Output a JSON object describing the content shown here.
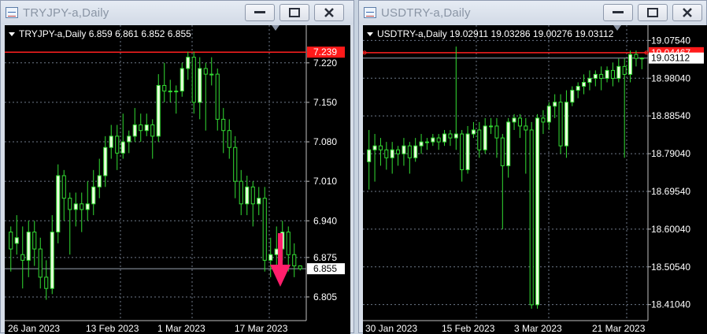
{
  "windows": [
    {
      "id": "tryjpy",
      "title": "TRYJPY-a,Daily",
      "info_label": "TRYJPY-a,Daily  6.859 6.861 6.852 6.855",
      "price_labels": [
        "7.220",
        "7.150",
        "7.080",
        "7.010",
        "6.940",
        "6.875",
        "6.805"
      ],
      "date_labels": [
        "26 Jan 2023",
        "13 Feb 2023",
        "1 Mar 2023",
        "17 Mar 2023"
      ],
      "red_line_label": "7.239",
      "current_price_label": "6.855",
      "chart_data": {
        "type": "candlestick",
        "symbol": "TRYJPY-a",
        "timeframe": "Daily",
        "ohlc_header": {
          "open": 6.859,
          "high": 6.861,
          "low": 6.852,
          "close": 6.855
        },
        "ylim": [
          6.77,
          7.27
        ],
        "y_ticks": [
          7.22,
          7.15,
          7.08,
          7.01,
          6.94,
          6.875,
          6.805
        ],
        "x_ticks": [
          "26 Jan 2023",
          "13 Feb 2023",
          "1 Mar 2023",
          "17 Mar 2023"
        ],
        "horizontal_line": 7.239,
        "current_price": 6.855,
        "candles": [
          [
            6.92,
            6.89,
            6.93,
            6.85
          ],
          [
            6.9,
            6.91,
            6.95,
            6.88
          ],
          [
            6.88,
            6.87,
            6.93,
            6.82
          ],
          [
            6.87,
            6.92,
            6.94,
            6.84
          ],
          [
            6.92,
            6.89,
            6.94,
            6.86
          ],
          [
            6.89,
            6.84,
            6.91,
            6.82
          ],
          [
            6.84,
            6.82,
            6.87,
            6.8
          ],
          [
            6.82,
            6.92,
            6.95,
            6.81
          ],
          [
            6.92,
            7.02,
            7.04,
            6.9
          ],
          [
            7.02,
            6.98,
            7.03,
            6.94
          ],
          [
            6.98,
            6.96,
            6.99,
            6.88
          ],
          [
            6.96,
            6.97,
            6.99,
            6.93
          ],
          [
            6.97,
            6.96,
            6.99,
            6.92
          ],
          [
            6.96,
            6.97,
            7.01,
            6.94
          ],
          [
            6.97,
            7.0,
            7.03,
            6.95
          ],
          [
            7.0,
            7.02,
            7.05,
            6.98
          ],
          [
            7.02,
            7.07,
            7.09,
            7.0
          ],
          [
            7.07,
            7.09,
            7.11,
            7.05
          ],
          [
            7.09,
            7.06,
            7.11,
            7.03
          ],
          [
            7.06,
            7.08,
            7.13,
            7.05
          ],
          [
            7.08,
            7.09,
            7.1,
            7.06
          ],
          [
            7.09,
            7.11,
            7.14,
            7.08
          ],
          [
            7.11,
            7.1,
            7.13,
            7.08
          ],
          [
            7.1,
            7.11,
            7.13,
            7.09
          ],
          [
            7.11,
            7.09,
            7.12,
            7.05
          ],
          [
            7.09,
            7.18,
            7.2,
            7.08
          ],
          [
            7.18,
            7.17,
            7.22,
            7.15
          ],
          [
            7.17,
            7.17,
            7.19,
            7.15
          ],
          [
            7.17,
            7.17,
            7.18,
            7.13
          ],
          [
            7.17,
            7.21,
            7.22,
            7.16
          ],
          [
            7.21,
            7.23,
            7.24,
            7.19
          ],
          [
            7.23,
            7.15,
            7.24,
            7.13
          ],
          [
            7.15,
            7.21,
            7.23,
            7.12
          ],
          [
            7.21,
            7.2,
            7.22,
            7.1
          ],
          [
            7.2,
            7.2,
            7.23,
            7.18
          ],
          [
            7.2,
            7.12,
            7.21,
            7.1
          ],
          [
            7.12,
            7.1,
            7.14,
            7.06
          ],
          [
            7.1,
            7.07,
            7.12,
            7.05
          ],
          [
            7.07,
            7.01,
            7.09,
            6.98
          ],
          [
            7.01,
            6.97,
            7.03,
            6.95
          ],
          [
            6.97,
            7.0,
            7.02,
            6.95
          ],
          [
            7.0,
            6.97,
            7.01,
            6.93
          ],
          [
            6.97,
            6.98,
            7.0,
            6.95
          ],
          [
            6.98,
            6.87,
            7.0,
            6.85
          ],
          [
            6.87,
            6.88,
            6.91,
            6.84
          ],
          [
            6.88,
            6.89,
            6.93,
            6.86
          ],
          [
            6.89,
            6.92,
            6.94,
            6.87
          ],
          [
            6.92,
            6.88,
            6.93,
            6.85
          ],
          [
            6.88,
            6.86,
            6.9,
            6.84
          ],
          [
            6.86,
            6.855,
            6.861,
            6.852
          ]
        ]
      }
    },
    {
      "id": "usdtry",
      "title": "USDTRY-a,Daily",
      "info_label": "USDTRY-a,Daily  19.02911 19.03286 19.00276 19.03112",
      "price_labels": [
        "19.07540",
        "18.98040",
        "18.88540",
        "18.79040",
        "18.69540",
        "18.60040",
        "18.50540",
        "18.41040"
      ],
      "date_labels": [
        "30 Jan 2023",
        "15 Feb 2023",
        "3 Mar 2023",
        "21 Mar 2023"
      ],
      "red_line_label": "19.04467",
      "current_price_label": "19.03112",
      "chart_data": {
        "type": "candlestick",
        "symbol": "USDTRY-a",
        "timeframe": "Daily",
        "ohlc_header": {
          "open": 19.02911,
          "high": 19.03286,
          "low": 19.00276,
          "close": 19.03112
        },
        "ylim": [
          18.38,
          19.09
        ],
        "y_ticks": [
          19.0754,
          18.9804,
          18.8854,
          18.7904,
          18.6954,
          18.6004,
          18.5054,
          18.4104
        ],
        "x_ticks": [
          "30 Jan 2023",
          "15 Feb 2023",
          "3 Mar 2023",
          "21 Mar 2023"
        ],
        "horizontal_line": 19.04467,
        "current_price": 19.03112,
        "candles": [
          [
            18.77,
            18.8,
            18.85,
            18.7
          ],
          [
            18.8,
            18.81,
            18.84,
            18.72
          ],
          [
            18.81,
            18.8,
            18.83,
            18.76
          ],
          [
            18.8,
            18.78,
            18.82,
            18.75
          ],
          [
            18.78,
            18.8,
            18.82,
            18.74
          ],
          [
            18.8,
            18.79,
            18.81,
            18.76
          ],
          [
            18.79,
            18.81,
            18.83,
            18.76
          ],
          [
            18.81,
            18.78,
            18.82,
            18.74
          ],
          [
            18.78,
            18.81,
            18.83,
            18.77
          ],
          [
            18.81,
            18.82,
            18.84,
            18.79
          ],
          [
            18.82,
            18.82,
            18.83,
            18.8
          ],
          [
            18.82,
            18.83,
            18.84,
            18.81
          ],
          [
            18.83,
            18.82,
            18.84,
            18.8
          ],
          [
            18.82,
            18.84,
            18.85,
            18.81
          ],
          [
            18.84,
            18.83,
            18.85,
            18.81
          ],
          [
            18.83,
            18.84,
            19.06,
            18.8
          ],
          [
            18.84,
            18.75,
            18.85,
            18.72
          ],
          [
            18.75,
            18.84,
            18.86,
            18.74
          ],
          [
            18.84,
            18.85,
            18.87,
            18.83
          ],
          [
            18.85,
            18.8,
            18.87,
            18.78
          ],
          [
            18.8,
            18.86,
            18.88,
            18.79
          ],
          [
            18.86,
            18.86,
            18.88,
            18.84
          ],
          [
            18.86,
            18.83,
            18.88,
            18.78
          ],
          [
            18.83,
            18.76,
            18.84,
            18.6
          ],
          [
            18.76,
            18.87,
            18.88,
            18.73
          ],
          [
            18.87,
            18.88,
            18.89,
            18.85
          ],
          [
            18.88,
            18.86,
            18.89,
            18.83
          ],
          [
            18.86,
            18.85,
            18.88,
            18.74
          ],
          [
            18.85,
            18.41,
            18.87,
            18.4
          ],
          [
            18.41,
            18.88,
            18.89,
            18.4
          ],
          [
            18.88,
            18.87,
            18.9,
            18.84
          ],
          [
            18.87,
            18.91,
            18.92,
            18.85
          ],
          [
            18.91,
            18.92,
            18.94,
            18.88
          ],
          [
            18.92,
            18.81,
            18.94,
            18.79
          ],
          [
            18.81,
            18.92,
            18.95,
            18.78
          ],
          [
            18.92,
            18.95,
            18.96,
            18.91
          ],
          [
            18.95,
            18.96,
            18.97,
            18.93
          ],
          [
            18.96,
            18.97,
            18.99,
            18.94
          ],
          [
            18.97,
            18.98,
            19.0,
            18.95
          ],
          [
            18.98,
            18.99,
            19.0,
            18.96
          ],
          [
            18.99,
            18.98,
            19.01,
            18.95
          ],
          [
            18.98,
            19.0,
            19.01,
            18.97
          ],
          [
            19.0,
            18.98,
            19.02,
            18.96
          ],
          [
            18.98,
            19.01,
            19.03,
            18.97
          ],
          [
            19.01,
            18.99,
            19.03,
            18.78
          ],
          [
            18.99,
            19.04,
            19.05,
            18.97
          ],
          [
            19.04,
            19.03,
            19.05,
            19.01
          ],
          [
            19.03,
            19.031,
            19.033,
            19.003
          ]
        ]
      }
    }
  ]
}
